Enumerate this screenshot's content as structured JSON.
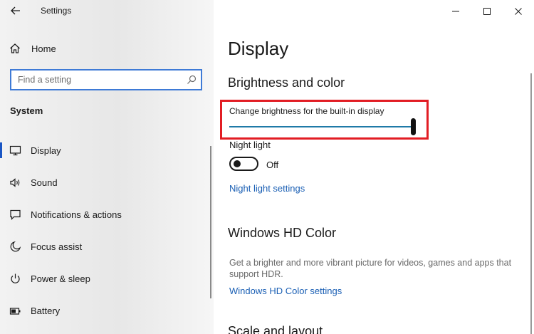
{
  "app": {
    "title": "Settings"
  },
  "sidebar": {
    "home_label": "Home",
    "search_placeholder": "Find a setting",
    "section_heading": "System",
    "items": [
      {
        "label": "Display",
        "icon": "monitor-icon",
        "selected": true
      },
      {
        "label": "Sound",
        "icon": "speaker-icon",
        "selected": false
      },
      {
        "label": "Notifications & actions",
        "icon": "notification-icon",
        "selected": false
      },
      {
        "label": "Focus assist",
        "icon": "moon-icon",
        "selected": false
      },
      {
        "label": "Power & sleep",
        "icon": "power-icon",
        "selected": false
      },
      {
        "label": "Battery",
        "icon": "battery-icon",
        "selected": false
      }
    ]
  },
  "main": {
    "page_title": "Display",
    "brightness_section": {
      "heading": "Brightness and color",
      "brightness_label": "Change brightness for the built-in display",
      "brightness_value": 100
    },
    "night_light": {
      "label": "Night light",
      "state": "Off",
      "settings_link": "Night light settings"
    },
    "hd_color": {
      "heading": "Windows HD Color",
      "description": "Get a brighter and more vibrant picture for videos, games and apps that support HDR.",
      "settings_link": "Windows HD Color settings"
    },
    "scale_layout": {
      "heading": "Scale and layout"
    }
  },
  "colors": {
    "accent": "#1a56c4",
    "link": "#1a5fb4",
    "highlight": "#e21d24",
    "slider_track": "#1f7aa8"
  }
}
